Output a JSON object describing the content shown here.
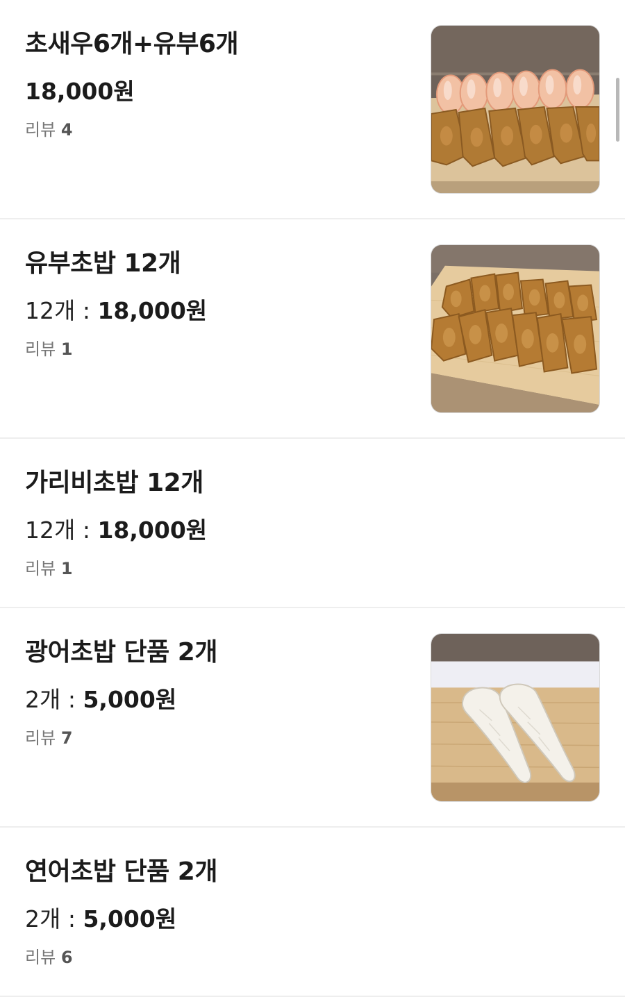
{
  "menu": {
    "review_label": "리뷰",
    "items": [
      {
        "name": "초새우6개+유부6개",
        "qty_label": "",
        "price": "18,000원",
        "review_count": "4",
        "has_image": true,
        "image_subject": "shrimp-and-inari-sushi"
      },
      {
        "name": "유부초밥 12개",
        "qty_label": "12개 : ",
        "price": "18,000원",
        "review_count": "1",
        "has_image": true,
        "image_subject": "inari-sushi"
      },
      {
        "name": "가리비초밥 12개",
        "qty_label": "12개 : ",
        "price": "18,000원",
        "review_count": "1",
        "has_image": false
      },
      {
        "name": "광어초밥 단품 2개",
        "qty_label": "2개 : ",
        "price": "5,000원",
        "review_count": "7",
        "has_image": true,
        "image_subject": "flatfish-sushi"
      },
      {
        "name": "연어초밥 단품 2개",
        "qty_label": "2개 : ",
        "price": "5,000원",
        "review_count": "6",
        "has_image": false
      }
    ]
  },
  "colors": {
    "text_primary": "#1b1b1b",
    "text_secondary": "#777777",
    "divider": "#eeeeee",
    "scrollbar": "#b8b8b8"
  }
}
